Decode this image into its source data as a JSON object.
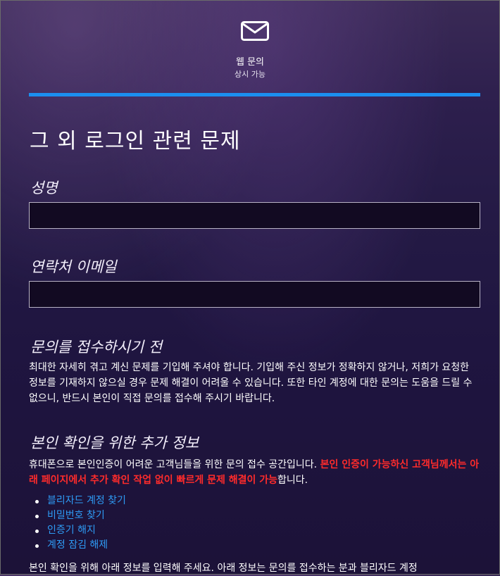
{
  "header": {
    "icon": "envelope-icon",
    "title": "웹 문의",
    "subtitle": "상시 가능"
  },
  "colors": {
    "accent": "#1b8ff0",
    "link": "#2e9bf5",
    "warning": "#ff2b2b",
    "background": "#241a45"
  },
  "page": {
    "title": "그 외 로그인 관련 문제"
  },
  "form": {
    "name_label": "성명",
    "name_value": "",
    "email_label": "연락처 이메일",
    "email_value": ""
  },
  "before_submit": {
    "heading": "문의를 접수하시기 전",
    "body": "최대한 자세히 겪고 계신 문제를 기입해 주셔야 합니다. 기입해 주신 정보가 정확하지 않거나, 저희가 요청한 정보를 기재하지 않으실 경우 문제 해결이 어려울 수 있습니다. 또한 타인 계정에 대한 문의는 도움을 드릴 수 없으니, 반드시 본인이 직접 문의를 접수해 주시기 바랍니다."
  },
  "extra_info": {
    "heading": "본인 확인을 위한 추가 정보",
    "body_prefix": "휴대폰으로 본인인증이 어려운 고객님들을 위한 문의 접수 공간입니다. ",
    "body_highlight": "본인 인증이 가능하신 고객님께서는 아래 페이지에서 추가 확인 작업 없이 빠르게 문제 해결이 가능",
    "body_suffix": "합니다.",
    "links": [
      {
        "label": "블리자드 계정 찾기"
      },
      {
        "label": "비밀번호 찾기"
      },
      {
        "label": "인증기 해지"
      },
      {
        "label": "계정 잠김 해제"
      }
    ],
    "footer_text": "본인 확인을 위해 아래 정보를 입력해 주세요. 아래 정보는 문의를 접수하는 분과 블리자드 계정"
  }
}
